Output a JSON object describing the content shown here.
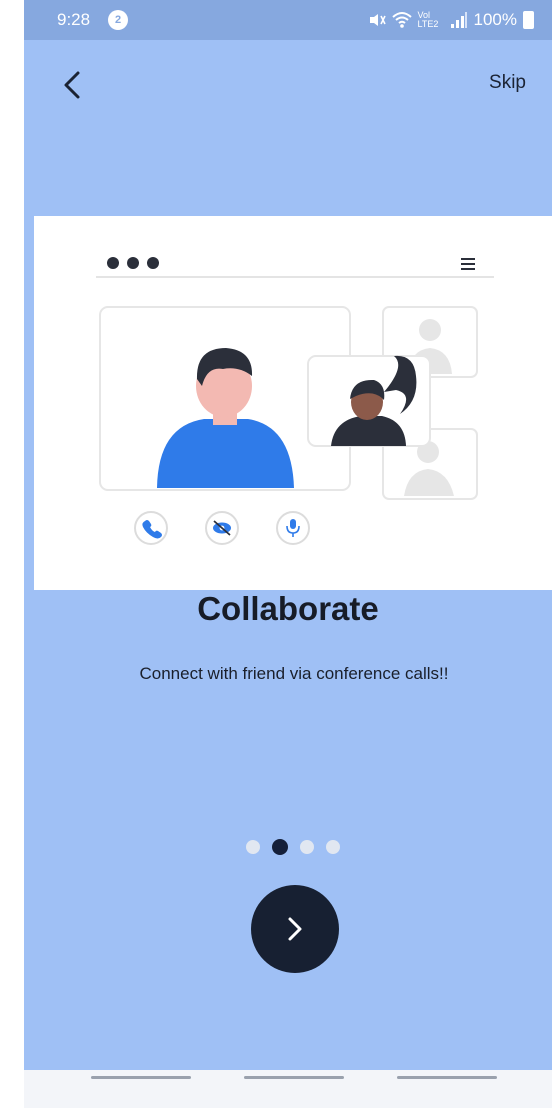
{
  "status_bar": {
    "time": "9:28",
    "notification_count": "2",
    "signal_text": "Vol LTE2",
    "battery": "100%"
  },
  "nav": {
    "skip_label": "Skip"
  },
  "onboarding": {
    "title": "Collaborate",
    "subtitle": "Connect with friend via conference calls!!",
    "page_count": 4,
    "active_page": 2
  },
  "colors": {
    "background": "#9fc0f5",
    "status_bar": "#86a8df",
    "accent_blue": "#2f7be9",
    "dark": "#172032"
  },
  "icons": {
    "back": "chevron-left-icon",
    "next": "chevron-right-icon",
    "call": "phone-icon",
    "video": "eye-off-icon",
    "mic": "mic-icon",
    "menu": "hamburger-icon"
  }
}
